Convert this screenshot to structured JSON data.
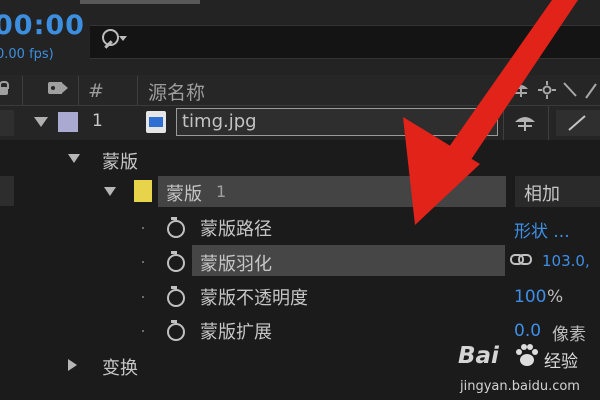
{
  "timecode": "00:00",
  "fps_label": "0.00 fps)",
  "search": {
    "placeholder": ""
  },
  "header": {
    "number_col": "#",
    "source_name_col": "源名称"
  },
  "layer": {
    "number": "1",
    "name": "timg.jpg",
    "label_color": "#a9a9d2"
  },
  "mask_group": {
    "label": "蒙版"
  },
  "mask1": {
    "name": "蒙版",
    "number": "1",
    "mode": "相加",
    "color": "#e8d44a"
  },
  "properties": [
    {
      "label": "蒙版路径",
      "value": "形状 ...",
      "unit": ""
    },
    {
      "label": "蒙版羽化",
      "value": "103.0,",
      "unit": ""
    },
    {
      "label": "蒙版不透明度",
      "value": "100",
      "unit": "%"
    },
    {
      "label": "蒙版扩展",
      "value": "0.0",
      "unit": "像素"
    }
  ],
  "transform_group": {
    "label": "变换"
  },
  "watermark": {
    "brand": "Bai",
    "brand_cn": "经验",
    "url": "jingyan.baidu.com"
  },
  "accent_color": "#3c8fe0",
  "annotation_arrow_color": "#e2231a"
}
